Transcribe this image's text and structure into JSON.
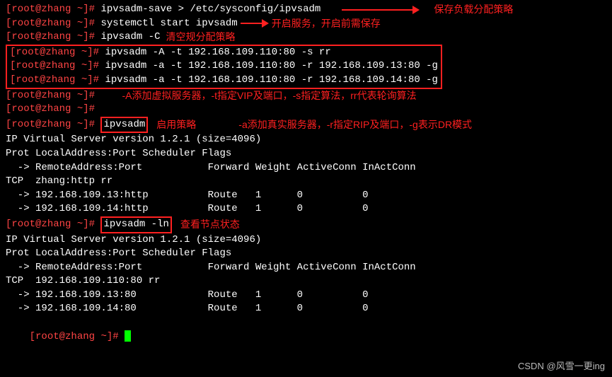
{
  "prompt": {
    "open": "[",
    "user": "root",
    "at": "@",
    "host": "zhang",
    "path": " ~",
    "close": "]# "
  },
  "lines": {
    "l1_cmd": "ipvsadm-save > /etc/sysconfig/ipvsadm",
    "l1_note": "保存负载分配策略",
    "l2_cmd": "systemctl start ipvsadm",
    "l2_note": "开启服务，开启前需保存",
    "l3_cmd": "ipvsadm -C",
    "l3_note": "清空规分配策略",
    "l4_cmd": "ipvsadm -A -t 192.168.109.110:80 -s rr",
    "l5_cmd": "ipvsadm -a -t 192.168.109.110:80 -r 192.168.109.13:80 -g",
    "l6_cmd": "ipvsadm -a -t 192.168.109.110:80 -r 192.168.109.14:80 -g",
    "note_A": "-A添加虚拟服务器，-t指定VIP及端口，-s指定算法，rr代表轮询算法",
    "note_a": "-a添加真实服务器，-r指定RIP及端口，-g表示DR模式",
    "l9_cmd": "ipvsadm",
    "l9_note": "启用策略",
    "out1": "IP Virtual Server version 1.2.1 (size=4096)",
    "out2": "Prot LocalAddress:Port Scheduler Flags",
    "out3": "  -> RemoteAddress:Port           Forward Weight ActiveConn InActConn",
    "out4": "TCP  zhang:http rr",
    "out5": "  -> 192.168.109.13:http          Route   1      0          0",
    "out6": "  -> 192.168.109.14:http          Route   1      0          0",
    "l10_cmd": "ipvsadm -ln",
    "l10_note": "查看节点状态",
    "out7": "IP Virtual Server version 1.2.1 (size=4096)",
    "out8": "Prot LocalAddress:Port Scheduler Flags",
    "out9": "  -> RemoteAddress:Port           Forward Weight ActiveConn InActConn",
    "out10": "TCP  192.168.109.110:80 rr",
    "out11": "  -> 192.168.109.13:80            Route   1      0          0",
    "out12": "  -> 192.168.109.14:80            Route   1      0          0"
  },
  "watermark": "CSDN @风雪一更ing"
}
